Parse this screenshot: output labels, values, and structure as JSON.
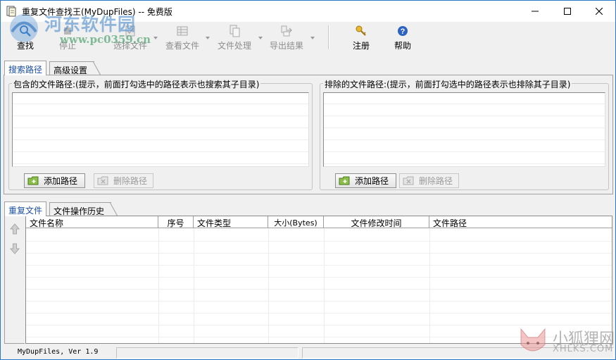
{
  "window": {
    "title": "重复文件查找王(MyDupFiles) -- 免费版"
  },
  "toolbar": {
    "items": [
      {
        "label": "查找",
        "icon": "search-icon",
        "enabled": true
      },
      {
        "label": "停止",
        "icon": "stop-icon",
        "enabled": false
      },
      {
        "label": "选择文件",
        "icon": "select-files-icon",
        "enabled": false
      },
      {
        "label": "查看文件",
        "icon": "view-file-icon",
        "enabled": false
      },
      {
        "label": "文件处理",
        "icon": "file-process-icon",
        "enabled": false
      },
      {
        "label": "导出结果",
        "icon": "export-icon",
        "enabled": false
      },
      {
        "label": "注册",
        "icon": "key-icon",
        "enabled": true
      },
      {
        "label": "帮助",
        "icon": "help-icon",
        "enabled": true
      }
    ]
  },
  "top_tabs": [
    {
      "label": "搜索路径",
      "active": true
    },
    {
      "label": "高级设置",
      "active": false
    }
  ],
  "include_group": {
    "legend": "包含的文件路径:(提示，前面打勾选中的路径表示也搜索其子目录)",
    "add_button": "添加路径",
    "delete_button": "删除路径"
  },
  "exclude_group": {
    "legend": "排除的文件路径:(提示，前面打勾选中的路径表示也排除其子目录)",
    "add_button": "添加路径",
    "delete_button": "删除路径"
  },
  "bottom_tabs": [
    {
      "label": "重复文件",
      "active": true
    },
    {
      "label": "文件操作历史",
      "active": false
    }
  ],
  "grid": {
    "columns": [
      "文件名称",
      "序号",
      "文件类型",
      "大小(Bytes)",
      "文件修改时间",
      "文件路径"
    ],
    "rows": []
  },
  "status": {
    "text": "MyDupFiles, Ver 1.9"
  },
  "watermarks": {
    "top_name": "河东软件园",
    "top_url": "www.pc0359.cn",
    "bottom_name": "小狐狸网",
    "bottom_url": "XHLKS.COM"
  },
  "colors": {
    "window_border": "#2b78c5",
    "active_tab_text": "#1a4fa0",
    "disabled_text": "#8d8d8d"
  }
}
